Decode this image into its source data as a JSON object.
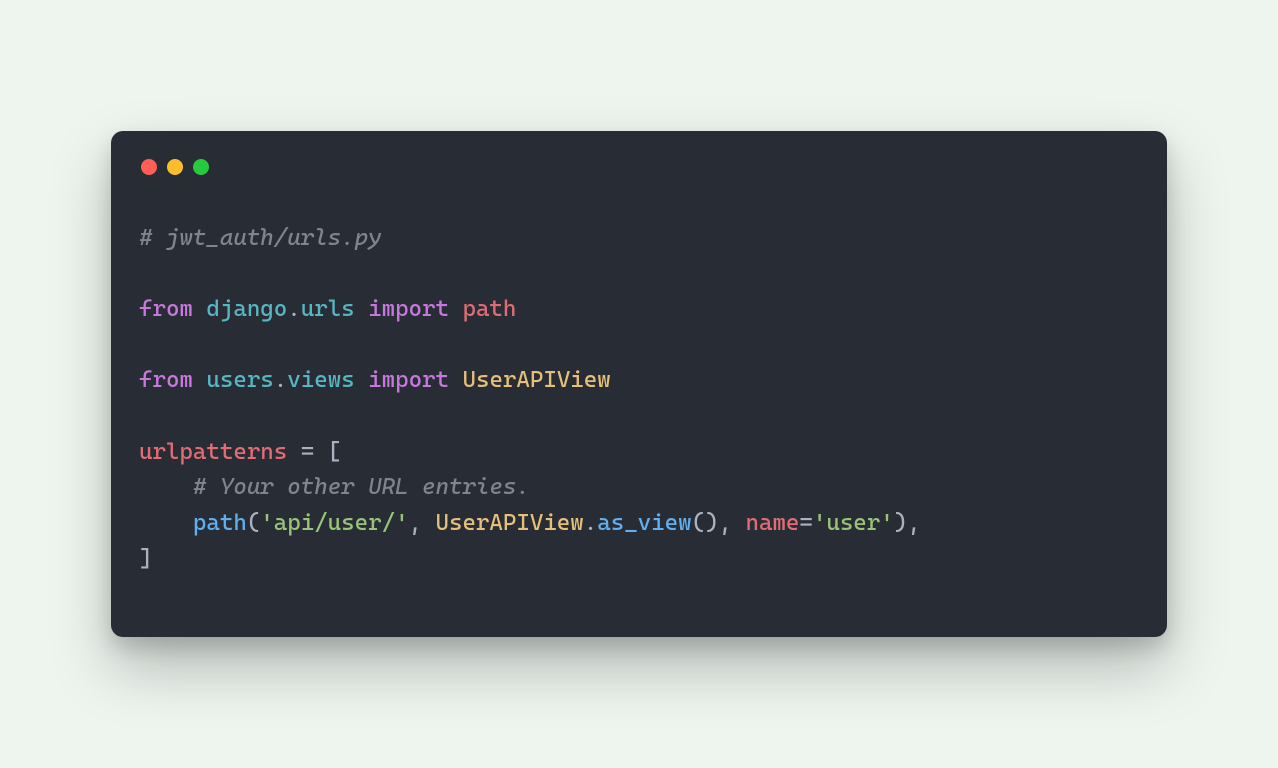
{
  "window": {
    "traffic": {
      "red": "#ff5f56",
      "yellow": "#ffbd2e",
      "green": "#27c93f"
    }
  },
  "code": {
    "l1": {
      "comment": "# jwt_auth/urls.py"
    },
    "l3": {
      "kw_from": "from",
      "mod1": "django",
      "dot1": ".",
      "mod2": "urls",
      "kw_import": "import",
      "name": "path"
    },
    "l5": {
      "kw_from": "from",
      "mod1": "users",
      "dot1": ".",
      "mod2": "views",
      "kw_import": "import",
      "cls": "UserAPIView"
    },
    "l7": {
      "var": "urlpatterns",
      "eq": " = ",
      "br": "["
    },
    "l8": {
      "indent": "    ",
      "comment": "# Your other URL entries."
    },
    "l9": {
      "indent": "    ",
      "fn": "path",
      "lp": "(",
      "str1": "'api/user/'",
      "c1": ", ",
      "cls": "UserAPIView",
      "dot": ".",
      "method": "as_view",
      "call": "()",
      "c2": ", ",
      "param": "name",
      "peq": "=",
      "str2": "'user'",
      "rp": "),"
    },
    "l10": {
      "br": "]"
    }
  }
}
